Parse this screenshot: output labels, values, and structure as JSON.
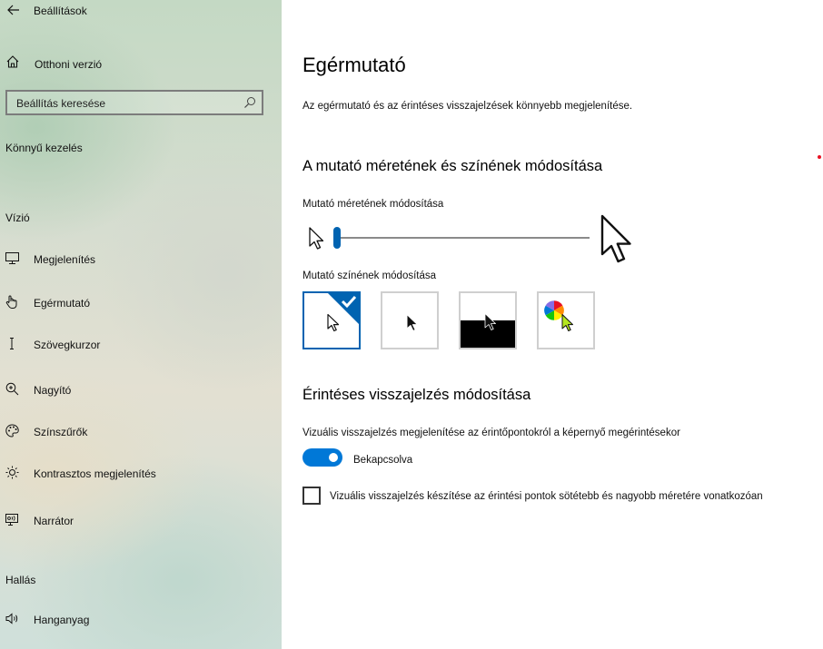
{
  "app": {
    "title": "Beállítások"
  },
  "sidebar": {
    "home_label": "Otthoni verzió",
    "search": {
      "placeholder": "Beállítás keresése"
    },
    "category": "Könnyű kezelés",
    "groups": [
      {
        "header": "Vízió",
        "items": [
          {
            "label": "Megjelenítés",
            "icon": "monitor-icon"
          },
          {
            "label": "Egérmutató",
            "icon": "hand-pointer-icon"
          },
          {
            "label": "Szövegkurzor",
            "icon": "text-cursor-icon"
          },
          {
            "label": "Nagyító",
            "icon": "magnifier-icon"
          },
          {
            "label": "Színszűrők",
            "icon": "palette-icon"
          },
          {
            "label": "Kontrasztos megjelenítés",
            "icon": "brightness-icon"
          },
          {
            "label": "Narrátor",
            "icon": "narrator-icon"
          }
        ]
      },
      {
        "header": "Hallás",
        "items": [
          {
            "label": "Hanganyag",
            "icon": "speaker-icon"
          }
        ]
      }
    ]
  },
  "main": {
    "title": "Egérmutató",
    "description": "Az egérmutató és az érintéses visszajelzések könnyebb megjelenítése.",
    "pointer_section": {
      "title": "A mutató méretének és színének módosítása",
      "size_label": "Mutató méretének módosítása",
      "size_value": 1,
      "size_max": 15,
      "color_label": "Mutató színének módosítása",
      "color_options": [
        {
          "name": "white",
          "selected": true
        },
        {
          "name": "black",
          "selected": false
        },
        {
          "name": "inverted",
          "selected": false
        },
        {
          "name": "custom",
          "selected": false
        }
      ]
    },
    "touch_section": {
      "title": "Érintéses visszajelzés módosítása",
      "toggle_label": "Vizuális visszajelzés megjelenítése az érintőpontokról a képernyő megérintésekor",
      "toggle_on": true,
      "toggle_state": "Bekapcsolva",
      "checkbox_label": "Vizuális visszajelzés készítése az érintési pontok sötétebb és nagyobb méretére vonatkozóan",
      "checkbox_checked": false
    }
  },
  "colors": {
    "accent": "#0078d7",
    "slider": "#0063b1",
    "custom_cursor": "#b4e61e"
  }
}
